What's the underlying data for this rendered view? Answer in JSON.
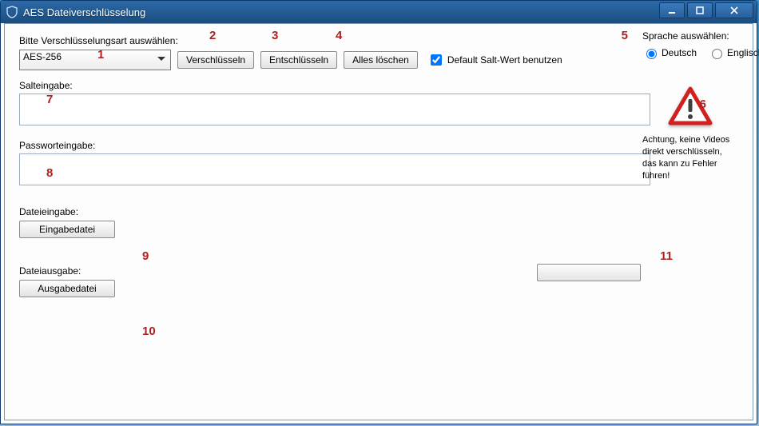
{
  "window": {
    "title": "AES Dateiverschlüsselung"
  },
  "toolbar": {
    "select_label": "Bitte Verschlüsselungsart auswählen:",
    "algo_selected": "AES-256",
    "encrypt": "Verschlüsseln",
    "decrypt": "Entschlüsseln",
    "clear": "Alles löschen",
    "salt_checkbox": "Default Salt-Wert benutzen",
    "salt_checked": true
  },
  "fields": {
    "salt_label": "Salteingabe:",
    "salt_value": "",
    "pwd_label": "Passworteingabe:",
    "pwd_value": "",
    "file_in_label": "Dateieingabe:",
    "file_in_btn": "Eingabedatei",
    "file_out_label": "Dateiausgabe:",
    "file_out_btn": "Ausgabedatei"
  },
  "lang": {
    "header": "Sprache auswählen:",
    "de": "Deutsch",
    "en": "Englisch",
    "selected": "de"
  },
  "warning": {
    "text": "Achtung, keine Videos direkt verschlüsseln, das kann zu Fehler führen!"
  },
  "annotations": {
    "a1": "1",
    "a2": "2",
    "a3": "3",
    "a4": "4",
    "a5": "5",
    "a6": "6",
    "a7": "7",
    "a8": "8",
    "a9": "9",
    "a10": "10",
    "a11": "11"
  }
}
